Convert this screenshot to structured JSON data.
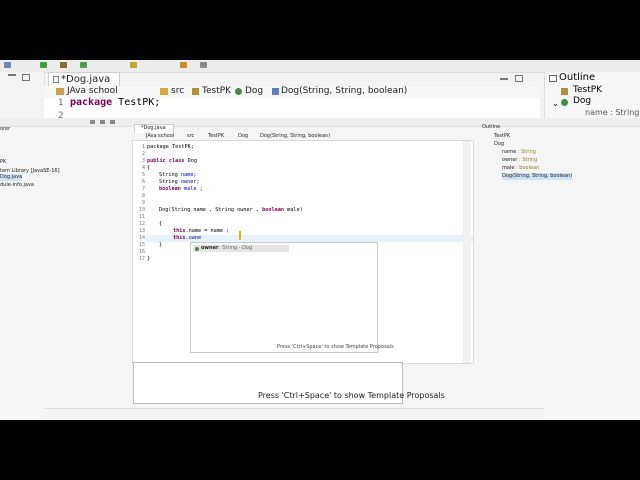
{
  "big": {
    "editor_tab": "*Dog.java",
    "breadcrumb": [
      "JAva school",
      "src",
      "TestPK",
      "Dog",
      "Dog(String, String, boolean)"
    ],
    "line1_no": "1",
    "line1_code": "package TestPK;",
    "line2_no": "2",
    "outline_tab": "Outline",
    "outline_items": [
      "TestPK",
      "Dog",
      "name : String"
    ],
    "popup_hint": "Press 'Ctrl+Space' to show Template Proposals"
  },
  "small": {
    "left_partial": [
      "orer",
      "PK",
      "tem Library [JavaSE-16]",
      "Dog.java",
      "dule-info.java"
    ],
    "editor_tab": "*Dog.java",
    "breadcrumb": [
      "JAva school",
      "src",
      "TestPK",
      "Dog",
      "Dog(String, String, boolean)"
    ],
    "line_numbers": [
      "1",
      "2",
      "3",
      "4",
      "5",
      "6",
      "7",
      "8",
      "9",
      "10",
      "11",
      "12",
      "13",
      "14",
      "15",
      "16",
      "17"
    ],
    "code": {
      "l1": "package TestPK;",
      "l3a": "public class",
      "l3b": " Dog",
      "l4": "{",
      "l5a": "String ",
      "l5b": "name",
      "l6a": "String ",
      "l6b": "owner",
      "l7a": "boolean ",
      "l7b": "male",
      "l10a": "Dog(String name , String owner , ",
      "l10b": "boolean",
      "l10c": " male)",
      "l12": "{",
      "l13a": "this",
      "l13b": ".name = name ;",
      "l14a": "this",
      "l14b": ".owne",
      "l15": "}",
      "l17": "}"
    },
    "proposal": {
      "name": "owner",
      "detail": ": String - Dog"
    },
    "popup_hint": "Press 'Ctrl+Space' to show Template Proposals",
    "outline_tab": "Outline",
    "outline": [
      {
        "name": "TestPK",
        "type": ""
      },
      {
        "name": "Dog",
        "type": ""
      },
      {
        "name": "name",
        "type": ": String"
      },
      {
        "name": "owner",
        "type": ": String"
      },
      {
        "name": "male",
        "type": ": boolean"
      },
      {
        "name": "Dog(String, String, boolean)",
        "type": ""
      }
    ]
  }
}
